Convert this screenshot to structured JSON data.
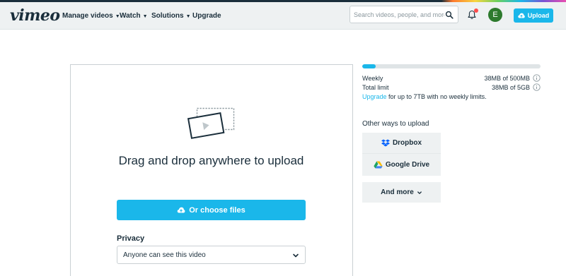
{
  "brand": {
    "logo_text": "vimeo",
    "accent": "#1ab7ea",
    "text": "#1a2e3b",
    "bar_bg": "#eef1f2"
  },
  "nav": {
    "items": [
      {
        "label": "Manage videos",
        "has_dropdown": true
      },
      {
        "label": "Watch",
        "has_dropdown": true
      },
      {
        "label": "Solutions",
        "has_dropdown": true
      },
      {
        "label": "Upgrade",
        "has_dropdown": false
      }
    ],
    "search_placeholder": "Search videos, people, and more",
    "search_icon": "search-icon",
    "notification_icon": "bell-icon",
    "avatar_initial": "E",
    "upload_label": "Upload",
    "upload_icon": "cloud-upload-icon"
  },
  "uploader": {
    "drag_text": "Drag and drop anywhere to upload",
    "choose_label": "Or choose files",
    "choose_icon": "cloud-upload-icon",
    "privacy_label": "Privacy",
    "privacy_value": "Anyone can see this video"
  },
  "quota": {
    "used_fraction": 0.076,
    "weekly_label": "Weekly",
    "weekly_value": "38MB of 500MB",
    "total_label": "Total limit",
    "total_value": "38MB of 5GB",
    "upgrade_link": "Upgrade",
    "upgrade_rest": " for up to 7TB with no weekly limits."
  },
  "other_ways": {
    "label": "Other ways to upload",
    "dropbox_label": "Dropbox",
    "gdrive_label": "Google Drive",
    "more_label": "And more"
  }
}
